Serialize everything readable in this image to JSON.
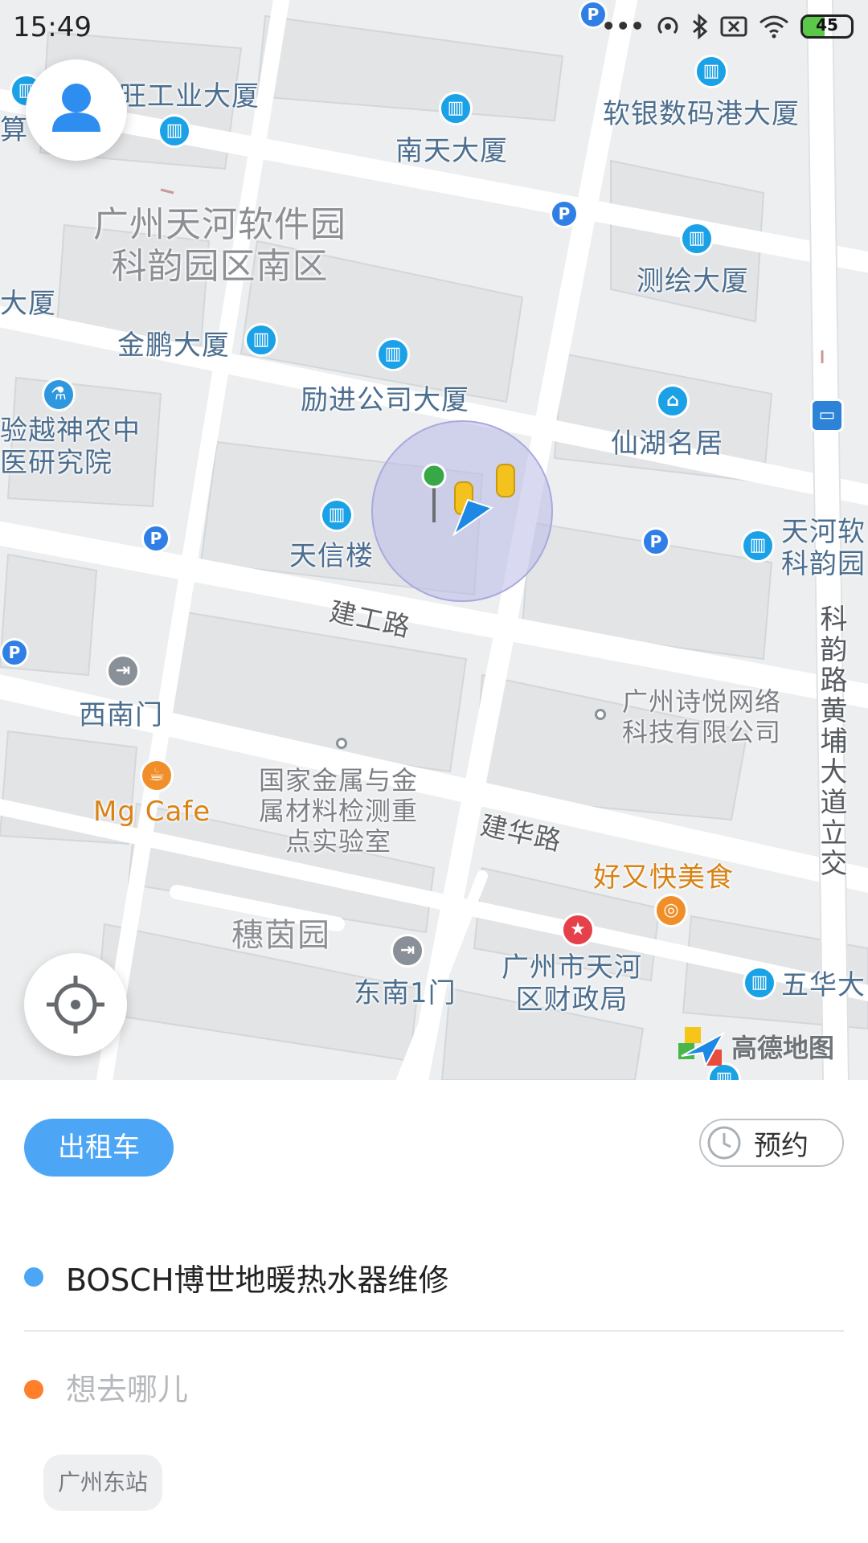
{
  "status_bar": {
    "time": "15:49",
    "battery": "45",
    "battery_level": 0.45,
    "icons": [
      "more-dots-icon",
      "hotspot-icon",
      "bluetooth-icon",
      "sim-x-icon",
      "wifi-icon",
      "battery-icon"
    ]
  },
  "map": {
    "pois": {
      "top_left_building": "旺工业大厦",
      "top_left_edge": "算",
      "nantian": "南天大厦",
      "ruanyin": "软银数码港大厦",
      "park_area": "广州天河软件园\n科韵园区南区",
      "edge_xia": "大厦",
      "cehui": "测绘大厦",
      "jinpeng": "金鹏大厦",
      "lijin": "励进公司大厦",
      "shennong": "验越神农中\n医研究院",
      "xianhu": "仙湖名居",
      "tianxin": "天信楼",
      "tianhe_right": "天河软\n科韵园",
      "xinanmen": "西南门",
      "shiyue": "广州诗悦网络\n科技有限公司",
      "metal_lab": "国家金属与金\n属材料检测重\n点实验室",
      "mg_cafe": "Mg Cafe",
      "haoyoukuai": "好又快美食",
      "suiyinyuan": "穗茵园",
      "dongnan1men": "东南1门",
      "caizhengju": "广州市天河\n区财政局",
      "wuhua": "五华大"
    },
    "roads": {
      "jiangong": "建工路",
      "jianhua": "建华路",
      "keyun": "科韵路黄埔大道立交"
    },
    "brand": "高德地图"
  },
  "panel": {
    "taxi_tab": "出租车",
    "reserve": "预约",
    "pickup": "BOSCH博世地暖热水器维修",
    "destination_placeholder": "想去哪儿",
    "quick_destination": "广州东站"
  },
  "colors": {
    "accent": "#4da6f5",
    "pickup_dot": "#4da6f5",
    "destination_dot": "#ff7f2a"
  }
}
